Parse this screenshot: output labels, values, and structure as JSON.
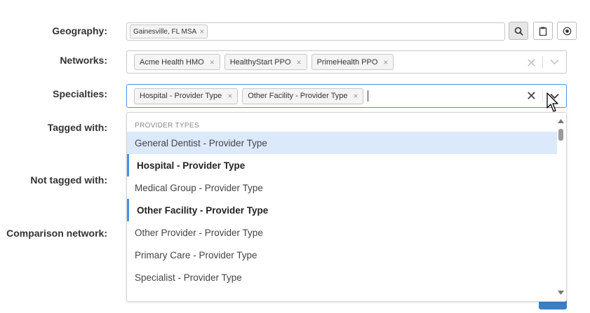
{
  "labels": {
    "geography": "Geography:",
    "networks": "Networks:",
    "specialties": "Specialties:",
    "tagged_with": "Tagged with:",
    "not_tagged_with": "Not tagged with:",
    "comparison_network": "Comparison network:"
  },
  "geography": {
    "chips": [
      "Gainesville, FL MSA"
    ]
  },
  "networks": {
    "chips": [
      "Acme Health HMO",
      "HealthyStart PPO",
      "PrimeHealth PPO"
    ]
  },
  "specialties": {
    "chips": [
      "Hospital - Provider Type",
      "Other Facility - Provider Type"
    ]
  },
  "chip_remove": "×",
  "dropdown": {
    "group_header": "PROVIDER TYPES",
    "options": [
      "General Dentist - Provider Type",
      "Hospital - Provider Type",
      "Medical Group - Provider Type",
      "Other Facility - Provider Type",
      "Other Provider - Provider Type",
      "Primary Care - Provider Type",
      "Specialist - Provider Type"
    ]
  },
  "colors": {
    "accent": "#4a90e2",
    "hover": "#dce9fb"
  }
}
